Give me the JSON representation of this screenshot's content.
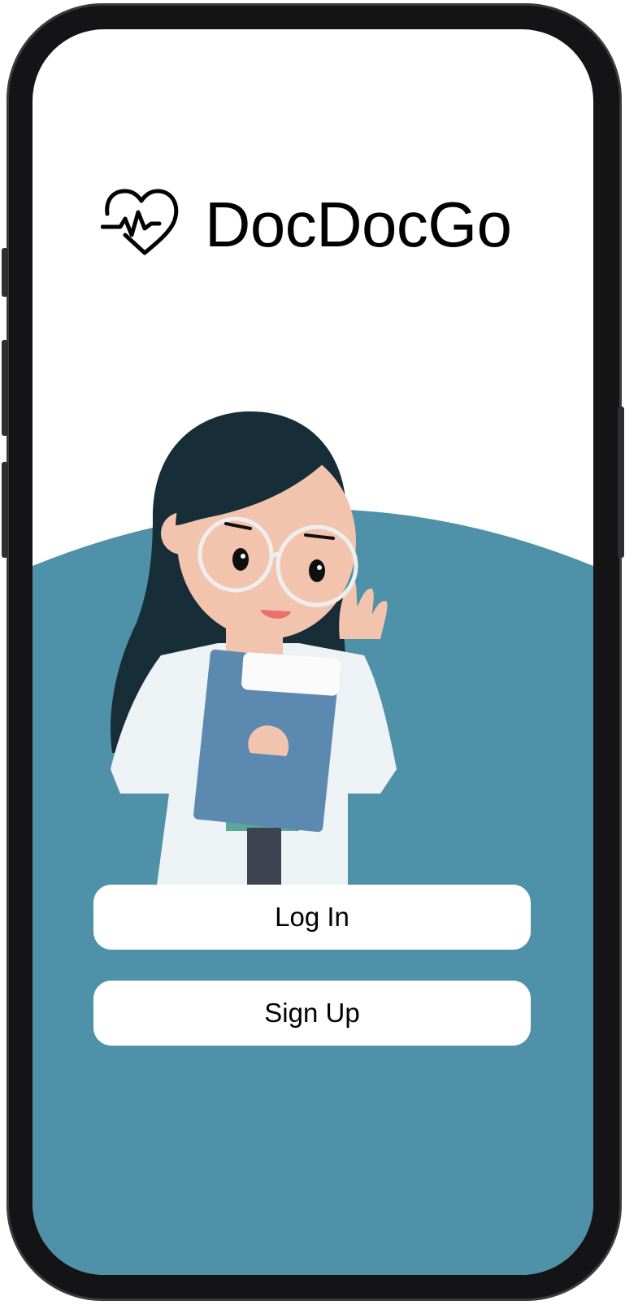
{
  "app": {
    "name": "DocDocGo",
    "logo_icon": "heart-pulse-icon"
  },
  "illustration": {
    "subject": "doctor-illustration"
  },
  "actions": {
    "login_label": "Log In",
    "signup_label": "Sign Up"
  },
  "colors": {
    "background": "#ffffff",
    "accent": "#4e91a8",
    "button": "#ffffff",
    "text": "#000000"
  }
}
